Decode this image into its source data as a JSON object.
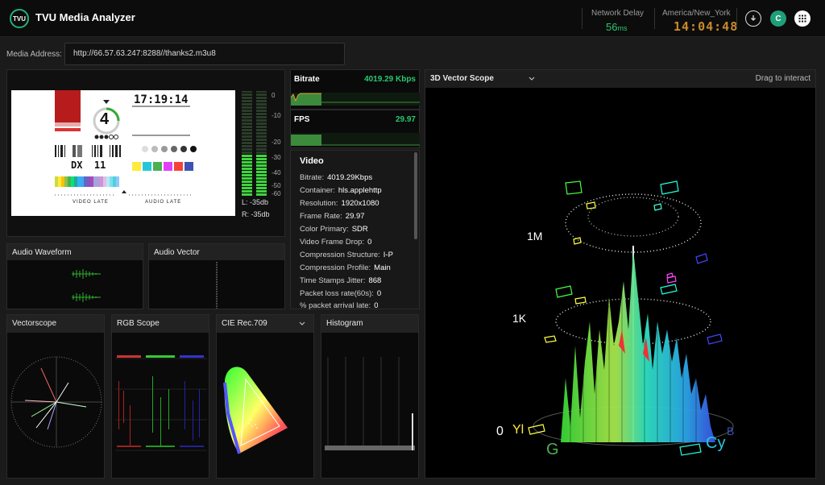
{
  "app": {
    "title": "TVU Media Analyzer",
    "logo_text": "TVU"
  },
  "header": {
    "network_delay_label": "Network Delay",
    "network_delay_value": "56",
    "network_delay_unit": "ms",
    "timezone_label": "America/New_York",
    "clock": "14:04:48",
    "user_initial": "C"
  },
  "media": {
    "label": "Media Address:",
    "url": "http://66.57.63.247:8288//thanks2.m3u8"
  },
  "preview": {
    "timecode": "17:19:14",
    "countdown": "4",
    "dx_label": "DX  11",
    "video_late": "VIDEO LATE",
    "audio_late": "AUDIO LATE",
    "meter_ticks": [
      "0",
      "-10",
      "-20",
      "-30",
      "-40",
      "-50",
      "-60"
    ],
    "left_db": "L: -35db",
    "right_db": "R: -35db"
  },
  "bitrate": {
    "label": "Bitrate",
    "value": "4019.29 Kbps"
  },
  "fps": {
    "label": "FPS",
    "value": "29.97"
  },
  "video_info": {
    "title": "Video",
    "rows": [
      {
        "label": "Bitrate:",
        "value": "4019.29Kbps"
      },
      {
        "label": "Container:",
        "value": "hls.applehttp"
      },
      {
        "label": "Resolution:",
        "value": "1920x1080"
      },
      {
        "label": "Frame Rate:",
        "value": "29.97"
      },
      {
        "label": "Color Primary:",
        "value": "SDR"
      },
      {
        "label": "Video Frame Drop:",
        "value": "0"
      },
      {
        "label": "Compression Structure:",
        "value": "I-P"
      },
      {
        "label": "Compression Profile:",
        "value": "Main"
      },
      {
        "label": "Time Stamps Jitter:",
        "value": "868"
      },
      {
        "label": "Packet loss rate(60s):",
        "value": "0"
      },
      {
        "label": "% packet arrival late:",
        "value": "0"
      }
    ]
  },
  "panels": {
    "audio_waveform": "Audio Waveform",
    "audio_vector": "Audio Vector",
    "vectorscope": "Vectorscope",
    "rgb_scope": "RGB Scope",
    "cie": "CIE Rec.709",
    "histogram": "Histogram",
    "vector3d": "3D Vector Scope",
    "drag_hint": "Drag to interact"
  },
  "scope3d_labels": {
    "m": "1M",
    "k": "1K",
    "zero": "0",
    "yl": "Yl",
    "g": "G",
    "cy": "Cy",
    "b": "B"
  },
  "colors": {
    "accent": "#28c76f",
    "clock": "#c98a2b"
  }
}
